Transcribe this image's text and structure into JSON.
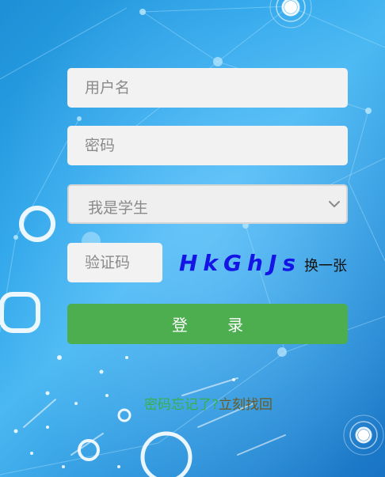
{
  "login": {
    "username_placeholder": "用户名",
    "password_placeholder": "密码",
    "role_selected": "我是学生",
    "captcha_placeholder": "验证码",
    "captcha_code": "HkGhJs",
    "refresh_label": "换一张",
    "login_label": "登 录",
    "forgot_question": "密码忘记了?",
    "forgot_link": "立刻找回"
  },
  "colors": {
    "login_button": "#4cae4f",
    "captcha_text": "#1414e6",
    "forgot_question": "#37b04b",
    "forgot_link": "#6b5a1e"
  }
}
